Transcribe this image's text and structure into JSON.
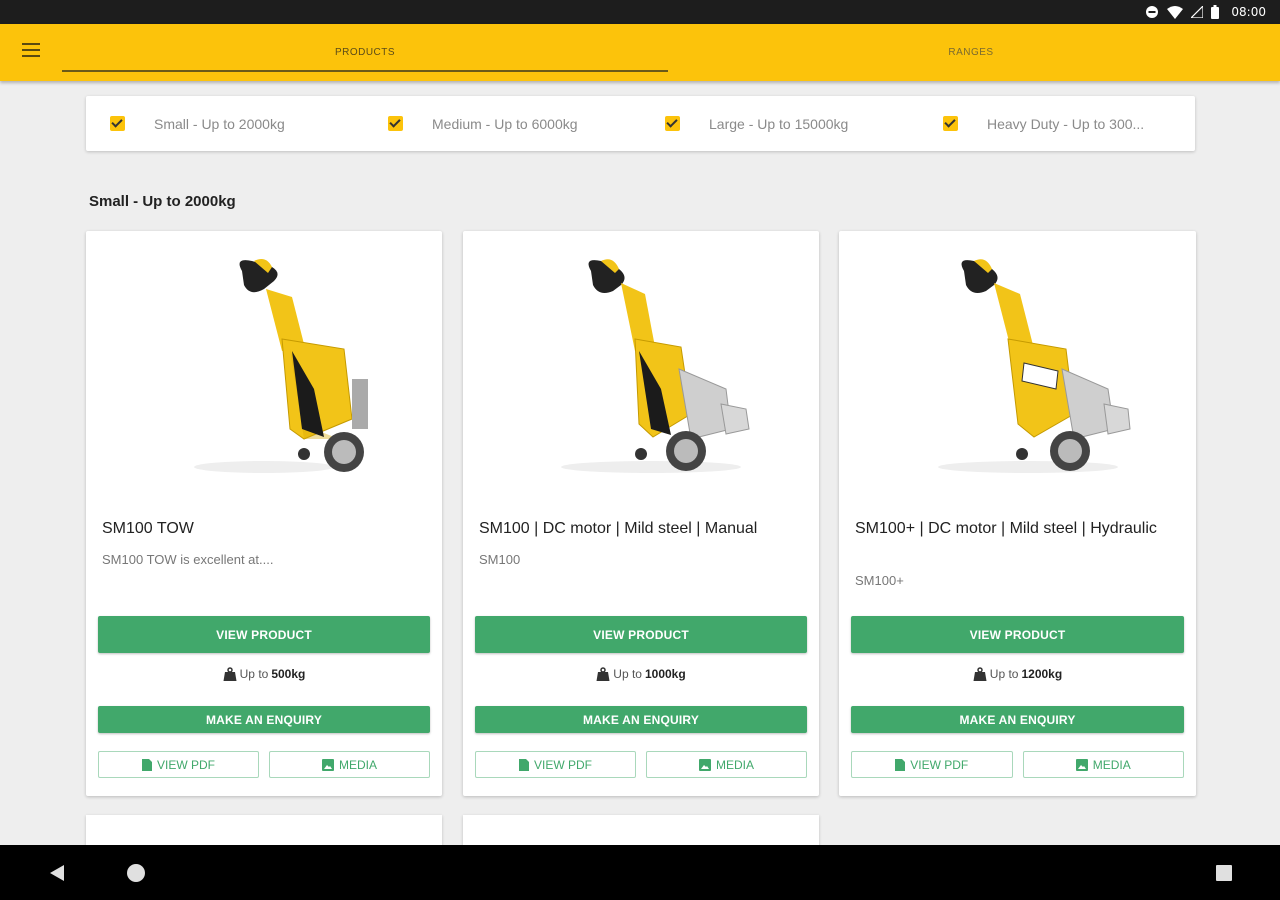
{
  "status_bar": {
    "time": "08:00"
  },
  "tabs": [
    {
      "label": "PRODUCTS"
    },
    {
      "label": "RANGES"
    }
  ],
  "filters": [
    {
      "label": "Small - Up to 2000kg",
      "checked": true
    },
    {
      "label": "Medium - Up to 6000kg",
      "checked": true
    },
    {
      "label": "Large - Up to 15000kg",
      "checked": true
    },
    {
      "label": "Heavy Duty - Up to 300...",
      "checked": true
    }
  ],
  "section_title": "Small - Up to 2000kg",
  "products": [
    {
      "name": "SM100 TOW",
      "description": "SM100 TOW is excellent at....",
      "view_label": "VIEW PRODUCT",
      "capacity_prefix": "Up to",
      "capacity_value": "500kg",
      "enquiry_label": "MAKE AN ENQUIRY",
      "pdf_label": "VIEW PDF",
      "media_label": "MEDIA"
    },
    {
      "name": "SM100 | DC motor | Mild steel | Manual",
      "description": "SM100",
      "view_label": "VIEW PRODUCT",
      "capacity_prefix": "Up to",
      "capacity_value": "1000kg",
      "enquiry_label": "MAKE AN ENQUIRY",
      "pdf_label": "VIEW PDF",
      "media_label": "MEDIA"
    },
    {
      "name": "SM100+ | DC motor | Mild steel | Hydraulic",
      "description": "SM100+",
      "view_label": "VIEW PRODUCT",
      "capacity_prefix": "Up to",
      "capacity_value": "1200kg",
      "enquiry_label": "MAKE AN ENQUIRY",
      "pdf_label": "VIEW PDF",
      "media_label": "MEDIA"
    }
  ],
  "colors": {
    "app_bar": "#fcc30b",
    "primary_button": "#41a86b",
    "product_yellow": "#f2c418"
  }
}
